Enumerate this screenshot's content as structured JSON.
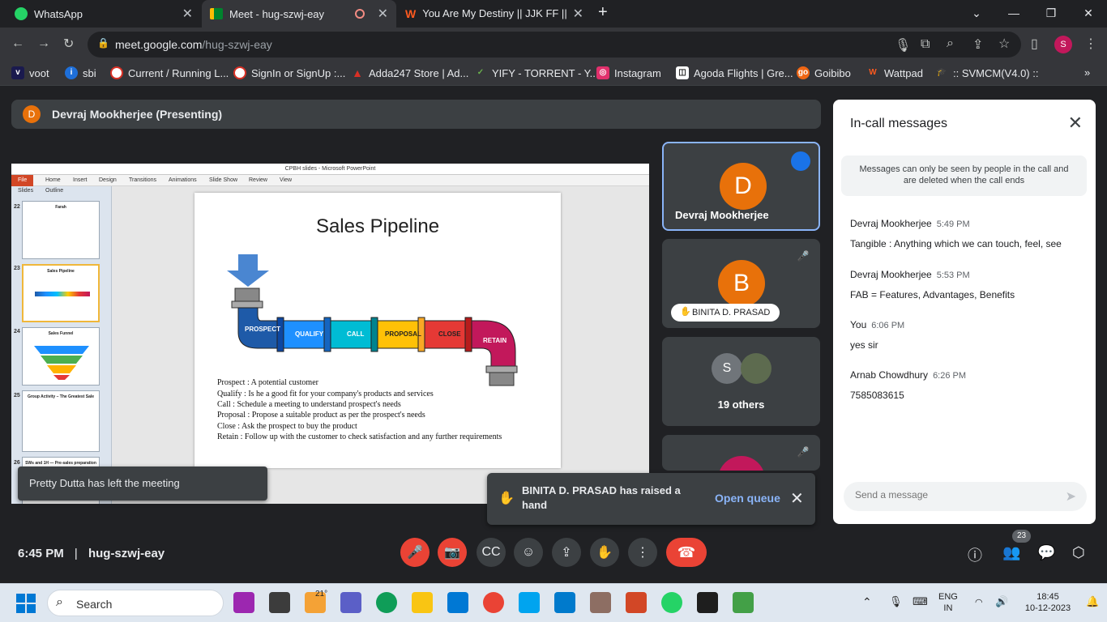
{
  "tabs": [
    {
      "title": "WhatsApp",
      "close": "✕"
    },
    {
      "title": "Meet - hug-szwj-eay",
      "close": "✕"
    },
    {
      "title": "You Are My Destiny || JJK FF || ✓",
      "close": "✕"
    }
  ],
  "new_tab": "+",
  "address": {
    "host": "meet.google.com",
    "path": "/hug-szwj-eay"
  },
  "profile_initial": "S",
  "bookmarks": [
    "voot",
    "sbi",
    "Current / Running L...",
    "SignIn or SignUp :...",
    "Adda247 Store | Ad...",
    "YIFY - TORRENT - Y...",
    "Instagram",
    "Agoda Flights | Gre...",
    "Goibibo",
    "Wattpad",
    ":: SVMCM(V4.0) ::"
  ],
  "presenter": {
    "initial": "D",
    "label": "Devraj Mookherjee (Presenting)"
  },
  "ppt": {
    "window_title": "CPBH slides - Microsoft PowerPoint",
    "file": "File",
    "ribbon": [
      "Home",
      "Insert",
      "Design",
      "Transitions",
      "Animations",
      "Slide Show",
      "Review",
      "View"
    ],
    "pane_tabs": [
      "Slides",
      "Outline"
    ],
    "thumbs": [
      {
        "num": "22",
        "title": "Farah"
      },
      {
        "num": "23",
        "title": "Sales Pipeline"
      },
      {
        "num": "24",
        "title": "Sales Funnel"
      },
      {
        "num": "25",
        "title": "Group Activity – The Greatest Sale"
      },
      {
        "num": "26",
        "title": "SWs and 1H — Pre-sales preparation"
      }
    ],
    "slide": {
      "title": "Sales Pipeline",
      "stages": [
        "PROSPECT",
        "QUALIFY",
        "CALL",
        "PROPOSAL",
        "CLOSE",
        "RETAIN"
      ],
      "lines": [
        "Prospect : A potential customer",
        "Qualify : Is he a good fit for your company's products and services",
        "Call : Schedule a meeting to understand prospect's needs",
        "Proposal : Propose a suitable product as per the prospect's needs",
        "Close : Ask the prospect to buy the product",
        "Retain : Follow up with the customer to check satisfaction and any further requirements"
      ]
    }
  },
  "toast_left": "Pretty Dutta has left the meeting",
  "hand_toast": {
    "message": "BINITA D. PRASAD has raised a hand",
    "action": "Open queue"
  },
  "tiles": [
    {
      "initial": "D",
      "name": "Devraj Mookherjee",
      "color": "#e8710a"
    },
    {
      "initial": "B",
      "name": "BINITA D. PRASAD",
      "color": "#e8710a"
    },
    {
      "initial": "S",
      "name": "19 others"
    }
  ],
  "chat": {
    "title": "In-call messages",
    "note": "Messages can only be seen by people in the call and are deleted when the call ends",
    "messages": [
      {
        "who": "Devraj Mookherjee",
        "time": "5:49 PM",
        "text": "Tangible : Anything which we can touch, feel, see"
      },
      {
        "who": "Devraj Mookherjee",
        "time": "5:53 PM",
        "text": "FAB = Features, Advantages, Benefits"
      },
      {
        "who": "You",
        "time": "6:06 PM",
        "text": "yes sir"
      },
      {
        "who": "Arnab Chowdhury",
        "time": "6:26 PM",
        "text": "7585083615"
      }
    ],
    "placeholder": "Send a message"
  },
  "footer": {
    "time": "6:45 PM",
    "separator": "|",
    "code": "hug-szwj-eay",
    "people_count": "23"
  },
  "taskbar": {
    "search": "Search",
    "weather": "21°",
    "lang": "ENG",
    "region": "IN",
    "clock_time": "18:45",
    "clock_date": "10-12-2023"
  }
}
